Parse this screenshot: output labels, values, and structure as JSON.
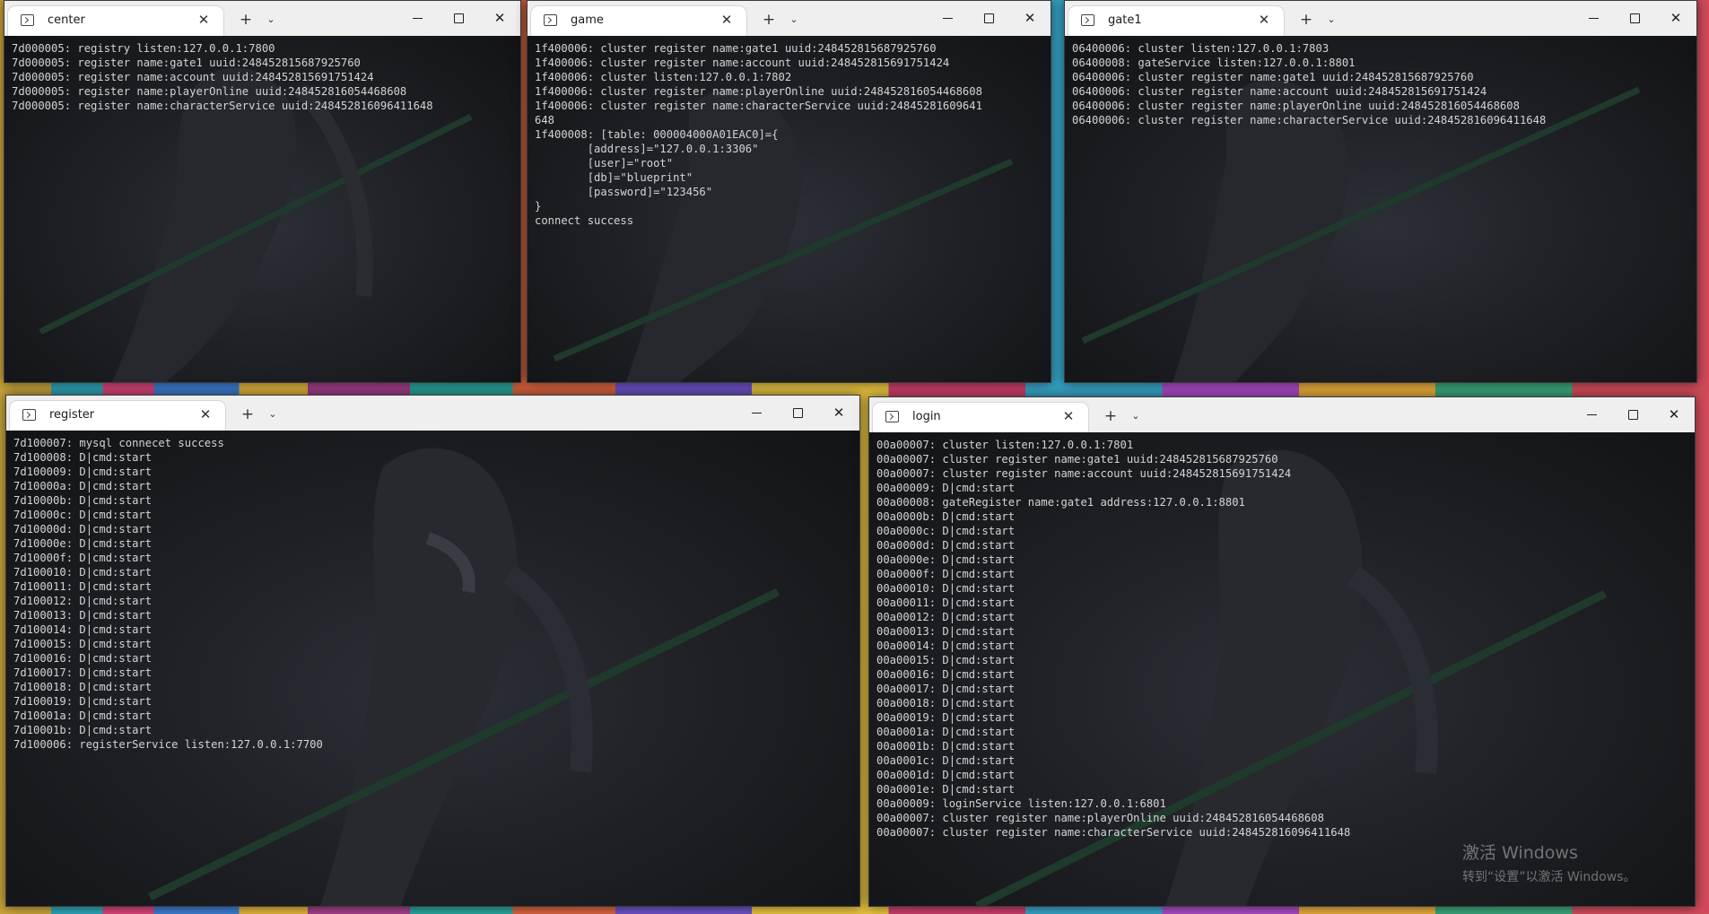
{
  "windows": [
    {
      "tab_title": "center",
      "lines": [
        "7d000005: registry listen:127.0.0.1:7800",
        "7d000005: register name:gate1 uuid:248452815687925760",
        "7d000005: register name:account uuid:248452815691751424",
        "7d000005: register name:playerOnline uuid:248452816054468608",
        "7d000005: register name:characterService uuid:248452816096411648"
      ]
    },
    {
      "tab_title": "game",
      "lines": [
        "1f400006: cluster register name:gate1 uuid:248452815687925760",
        "1f400006: cluster register name:account uuid:248452815691751424",
        "1f400006: cluster listen:127.0.0.1:7802",
        "1f400006: cluster register name:playerOnline uuid:248452816054468608",
        "1f400006: cluster register name:characterService uuid:24845281609641",
        "648",
        "1f400008: [table: 000004000A01EAC0]={",
        "        [address]=\"127.0.0.1:3306\"",
        "        [user]=\"root\"",
        "        [db]=\"blueprint\"",
        "        [password]=\"123456\"",
        "}",
        "connect success"
      ]
    },
    {
      "tab_title": "gate1",
      "lines": [
        "06400006: cluster listen:127.0.0.1:7803",
        "06400008: gateService listen:127.0.0.1:8801",
        "06400006: cluster register name:gate1 uuid:248452815687925760",
        "06400006: cluster register name:account uuid:248452815691751424",
        "06400006: cluster register name:playerOnline uuid:248452816054468608",
        "06400006: cluster register name:characterService uuid:248452816096411648"
      ]
    },
    {
      "tab_title": "register",
      "lines": [
        "7d100007: mysql connecet success",
        "7d100008: D|cmd:start",
        "7d100009: D|cmd:start",
        "7d10000a: D|cmd:start",
        "7d10000b: D|cmd:start",
        "7d10000c: D|cmd:start",
        "7d10000d: D|cmd:start",
        "7d10000e: D|cmd:start",
        "7d10000f: D|cmd:start",
        "7d100010: D|cmd:start",
        "7d100011: D|cmd:start",
        "7d100012: D|cmd:start",
        "7d100013: D|cmd:start",
        "7d100014: D|cmd:start",
        "7d100015: D|cmd:start",
        "7d100016: D|cmd:start",
        "7d100017: D|cmd:start",
        "7d100018: D|cmd:start",
        "7d100019: D|cmd:start",
        "7d10001a: D|cmd:start",
        "7d10001b: D|cmd:start",
        "7d100006: registerService listen:127.0.0.1:7700"
      ]
    },
    {
      "tab_title": "login",
      "lines": [
        "00a00007: cluster listen:127.0.0.1:7801",
        "00a00007: cluster register name:gate1 uuid:248452815687925760",
        "00a00007: cluster register name:account uuid:248452815691751424",
        "00a00009: D|cmd:start",
        "00a00008: gateRegister name:gate1 address:127.0.0.1:8801",
        "00a0000b: D|cmd:start",
        "00a0000c: D|cmd:start",
        "00a0000d: D|cmd:start",
        "00a0000e: D|cmd:start",
        "00a0000f: D|cmd:start",
        "00a00010: D|cmd:start",
        "00a00011: D|cmd:start",
        "00a00012: D|cmd:start",
        "00a00013: D|cmd:start",
        "00a00014: D|cmd:start",
        "00a00015: D|cmd:start",
        "00a00016: D|cmd:start",
        "00a00017: D|cmd:start",
        "00a00018: D|cmd:start",
        "00a00019: D|cmd:start",
        "00a0001a: D|cmd:start",
        "00a0001b: D|cmd:start",
        "00a0001c: D|cmd:start",
        "00a0001d: D|cmd:start",
        "00a0001e: D|cmd:start",
        "00a00009: loginService listen:127.0.0.1:6801",
        "00a00007: cluster register name:playerOnline uuid:248452816054468608",
        "00a00007: cluster register name:characterService uuid:248452816096411648"
      ]
    }
  ],
  "watermark": {
    "line1": "激活 Windows",
    "line2": "转到“设置”以激活 Windows。"
  },
  "colors": {
    "terminal_bg": "#0c0c0c",
    "terminal_text": "#d4d4d4",
    "titlebar_bg": "#efefef",
    "tab_bg": "#ffffff"
  },
  "icons": {
    "tab": "terminal-icon",
    "new_tab": "plus-icon",
    "dropdown": "chevron-down-icon",
    "minimize": "minimize-icon",
    "maximize": "maximize-icon",
    "close": "close-icon"
  }
}
